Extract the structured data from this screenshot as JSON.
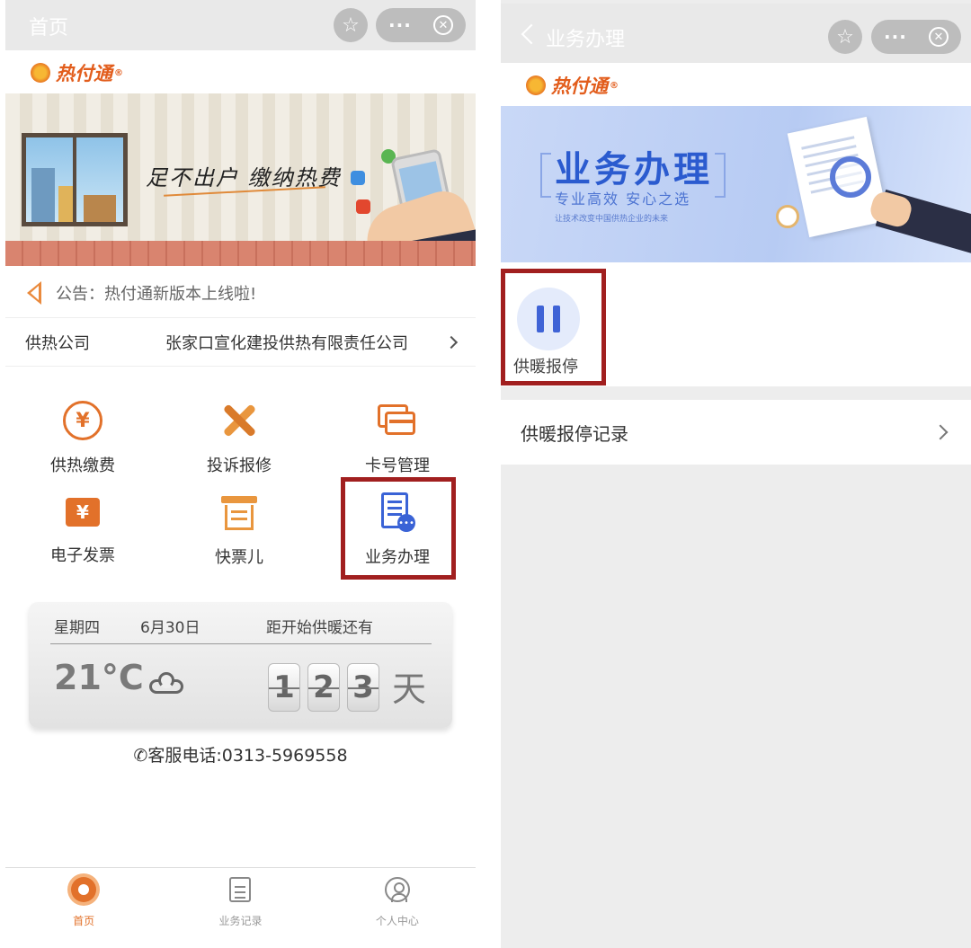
{
  "left_screen": {
    "titlebar": {
      "title": "首页"
    },
    "logo": {
      "text": "热付通",
      "mark": "®"
    },
    "banner": {
      "slogan": "足不出户 缴纳热费"
    },
    "notice": {
      "text": "公告：热付通新版本上线啦!"
    },
    "company": {
      "label": "供热公司",
      "value": "张家口宣化建投供热有限责任公司"
    },
    "grid": [
      {
        "label": "供热缴费",
        "icon": "yuan-coin-icon"
      },
      {
        "label": "投诉报修",
        "icon": "tools-icon"
      },
      {
        "label": "卡号管理",
        "icon": "cards-icon"
      },
      {
        "label": "电子发票",
        "icon": "invoice-icon"
      },
      {
        "label": "快票儿",
        "icon": "receipt-icon"
      },
      {
        "label": "业务办理",
        "icon": "business-doc-icon"
      }
    ],
    "weather": {
      "weekday": "星期四",
      "date": "6月30日",
      "countdown_label": "距开始供暖还有",
      "temperature": "21°C",
      "icon": "cloud-icon",
      "digits": [
        "1",
        "2",
        "3"
      ],
      "unit": "天"
    },
    "hotline": "✆客服电话:0313-5969558",
    "tabbar": [
      {
        "label": "首页",
        "icon": "home-gear-icon",
        "active": true
      },
      {
        "label": "业务记录",
        "icon": "note-icon",
        "active": false
      },
      {
        "label": "个人中心",
        "icon": "user-icon",
        "active": false
      }
    ]
  },
  "right_screen": {
    "titlebar": {
      "title": "业务办理"
    },
    "logo": {
      "text": "热付通",
      "mark": "®"
    },
    "banner": {
      "title": "业务办理",
      "subtitle": "专业高效  安心之选",
      "tagline": "让技术改变中国供热企业的未来"
    },
    "pause_action": {
      "label": "供暖报停"
    },
    "record_row": {
      "label": "供暖报停记录"
    }
  },
  "colors": {
    "brand_orange": "#e2712a",
    "accent_blue": "#3f63d6",
    "highlight_red": "#a11f1f",
    "titlebar_gray": "#e9e9e9"
  }
}
